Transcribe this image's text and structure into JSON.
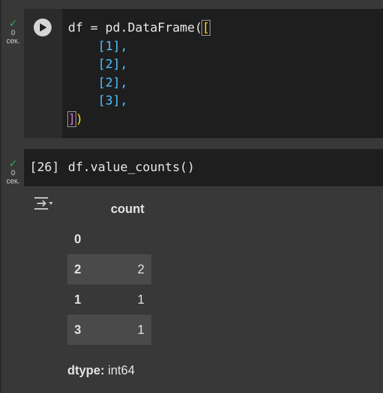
{
  "cell1": {
    "status_time": "0",
    "status_unit": "сек.",
    "code_lines": [
      "df = pd.DataFrame(",
      "[1],",
      "[2],",
      "[2],",
      "[3],",
      ")"
    ]
  },
  "cell2": {
    "status_time": "0",
    "status_unit": "сек.",
    "exec_count": "[26]",
    "code": "df.value_counts()"
  },
  "output": {
    "column_header": "count",
    "index_name": "0",
    "rows": [
      {
        "index": "2",
        "value": "2"
      },
      {
        "index": "1",
        "value": "1"
      },
      {
        "index": "3",
        "value": "1"
      }
    ],
    "dtype_label": "dtype:",
    "dtype_value": "int64"
  },
  "colors": {
    "success": "#34a853",
    "bracket_yellow": "#ffd700",
    "bracket_purple": "#da70d6",
    "number_blue": "#4fc1ff"
  },
  "icons": [
    "checkmark-icon",
    "play-icon",
    "output-toggle-icon"
  ]
}
